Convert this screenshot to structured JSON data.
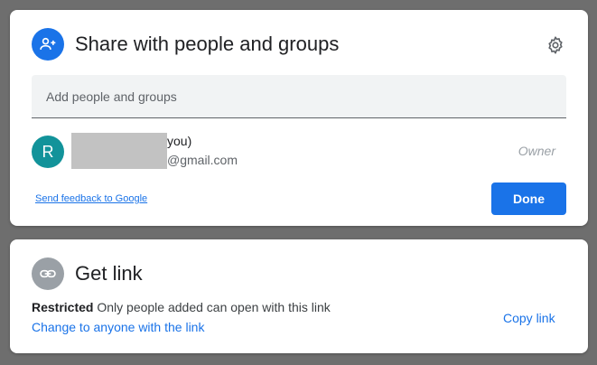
{
  "share": {
    "title": "Share with people and groups",
    "icon": "person-add-icon",
    "settings_icon": "gear-icon",
    "add_placeholder": "Add people and groups",
    "user": {
      "avatar_letter": "R",
      "avatar_color": "#12939a",
      "name_suffix": "you)",
      "email_suffix": "@gmail.com",
      "role": "Owner"
    },
    "feedback_link": "Send feedback to Google",
    "done_label": "Done"
  },
  "get_link": {
    "title": "Get link",
    "icon": "link-icon",
    "access_level": "Restricted",
    "access_description": "Only people added can open with this link",
    "change_label": "Change to anyone with the link",
    "copy_label": "Copy link"
  },
  "colors": {
    "accent": "#1a73e8",
    "overlay": "#6e6e6e"
  }
}
